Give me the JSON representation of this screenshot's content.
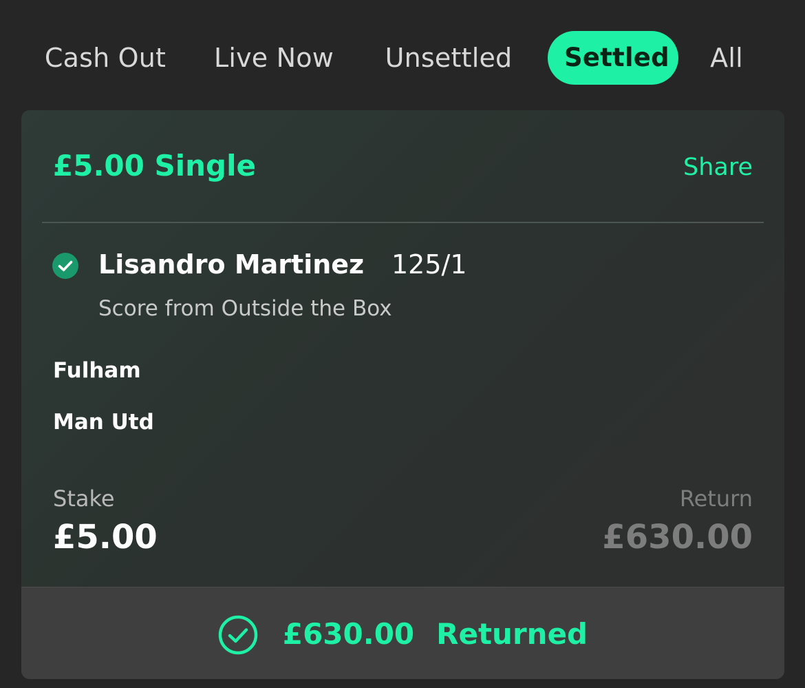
{
  "tabs": [
    {
      "label": "Cash Out",
      "active": false
    },
    {
      "label": "Live Now",
      "active": false
    },
    {
      "label": "Unsettled",
      "active": false
    },
    {
      "label": "Settled",
      "active": true
    },
    {
      "label": "All",
      "active": false
    }
  ],
  "colors": {
    "accent": "#1ef0a6",
    "background": "#262626",
    "success_check": "#1a9a6c"
  },
  "bet": {
    "title": "£5.00 Single",
    "share_label": "Share",
    "selection": {
      "status_icon": "check-circle-icon",
      "name": "Lisandro Martinez",
      "odds": "125/1",
      "market": "Score from Outside the Box"
    },
    "event": {
      "home": "Fulham",
      "away": "Man Utd"
    },
    "stake_label": "Stake",
    "stake_value": "£5.00",
    "return_label": "Return",
    "return_value": "£630.00",
    "footer": {
      "icon": "check-circle-outline-icon",
      "amount": "£630.00",
      "label": "Returned"
    }
  }
}
